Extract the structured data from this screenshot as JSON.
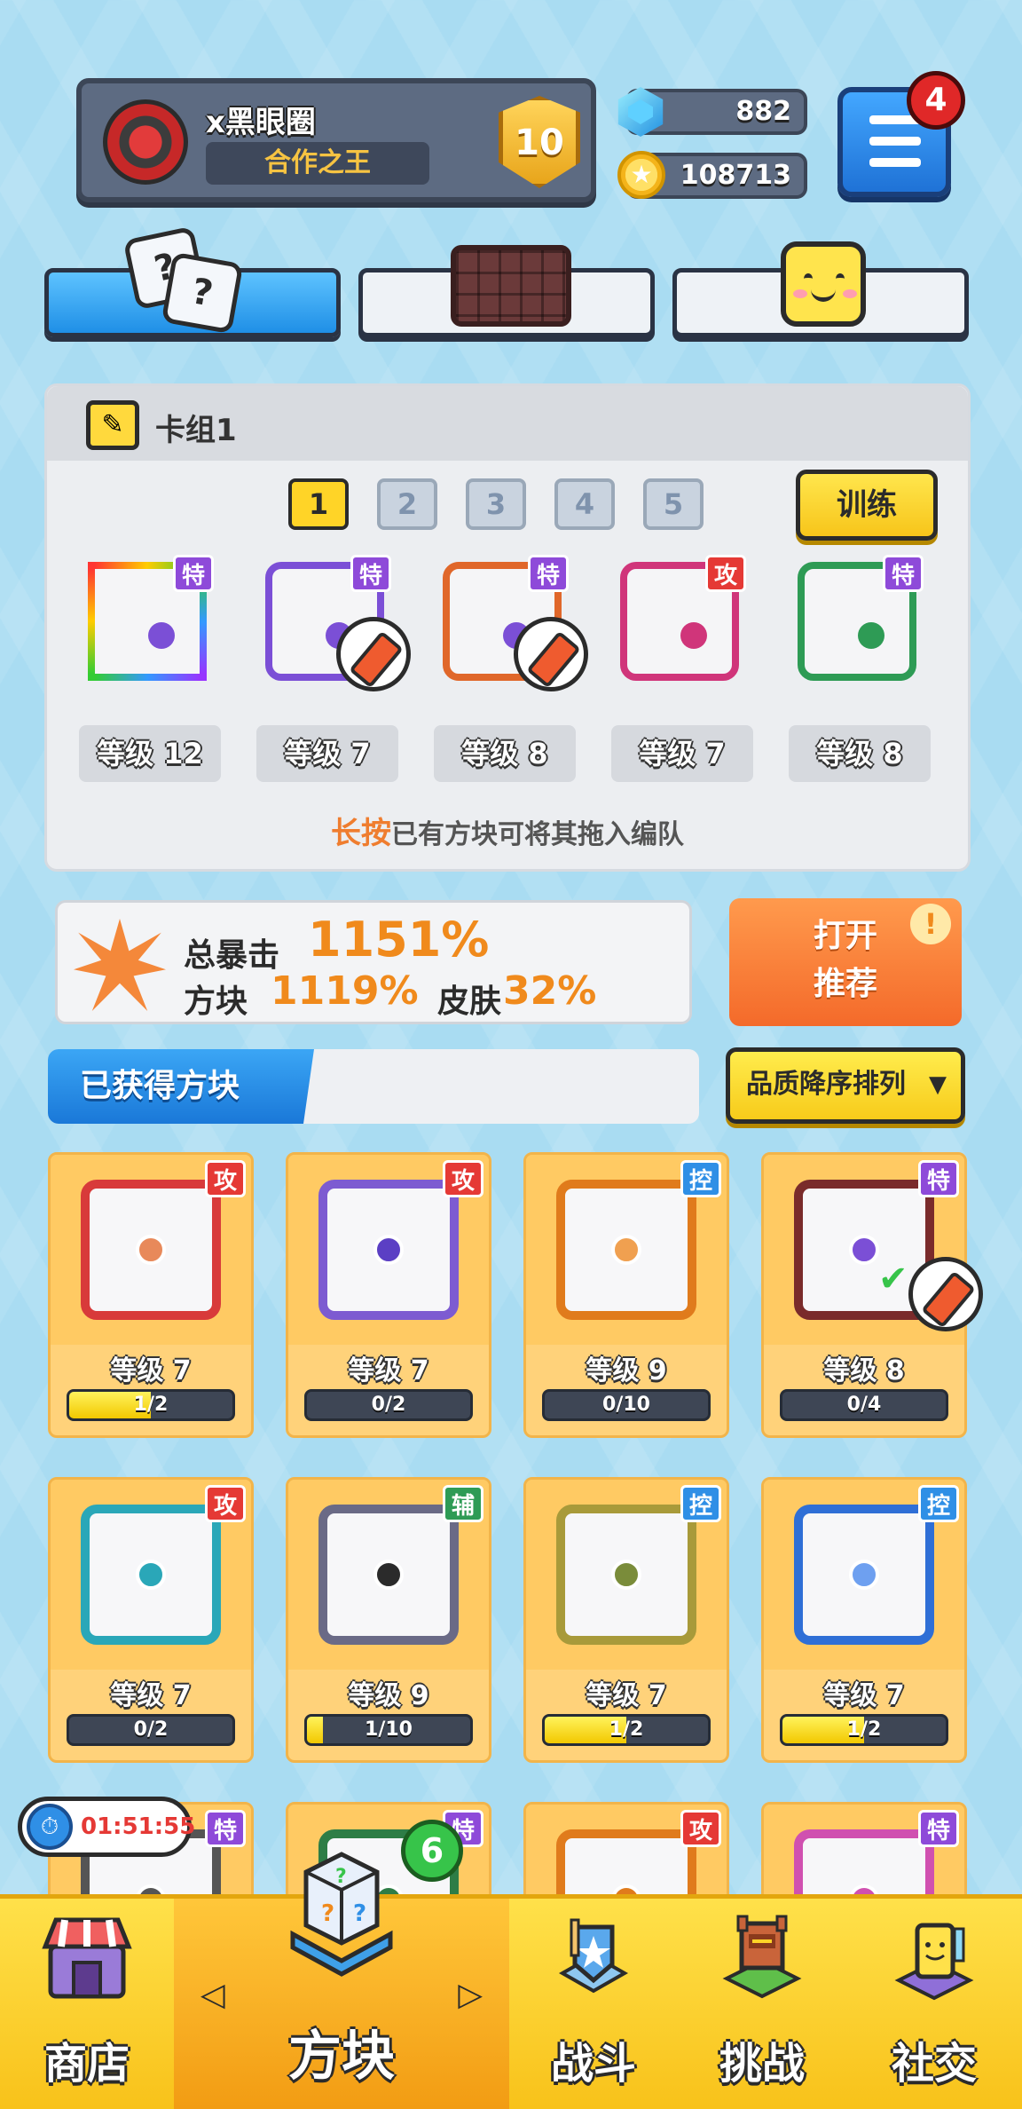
{
  "profile": {
    "name": "x黑眼圈",
    "title": "合作之王",
    "rank": "10"
  },
  "currency": {
    "gems": "882",
    "coins": "108713"
  },
  "menu": {
    "notification_count": "4"
  },
  "mode_tabs": [
    {
      "icon": "dice-icon",
      "active": true
    },
    {
      "icon": "chocolate-board-icon",
      "active": false
    },
    {
      "icon": "smiley-block-icon",
      "active": false
    }
  ],
  "deck": {
    "title": "卡组1",
    "numbers": [
      "1",
      "2",
      "3",
      "4",
      "5"
    ],
    "active_number": "1",
    "train_label": "训练",
    "cards": [
      {
        "tag": "特",
        "level": "等级 12",
        "color": "#7b4fd6"
      },
      {
        "tag": "特",
        "level": "等级 7",
        "color": "#7b4fd6"
      },
      {
        "tag": "特",
        "level": "等级 8",
        "color": "#7b4fd6"
      },
      {
        "tag": "攻",
        "level": "等级 7",
        "color": "#d0357a"
      },
      {
        "tag": "特",
        "level": "等级 8",
        "color": "#2e9b55"
      }
    ],
    "hint_highlight": "长按",
    "hint_rest": "已有方块可将其拖入编队"
  },
  "crit": {
    "total_label": "总暴击",
    "total_value": "1151%",
    "block_label": "方块",
    "block_value": "1119%",
    "skin_label": "皮肤",
    "skin_value": "32%"
  },
  "recommend": {
    "line1": "打开",
    "line2": "推荐",
    "alert": "!"
  },
  "obtained": {
    "tab_label": "已获得方块",
    "sort_label": "品质降序排列",
    "sort_arrow": "▼"
  },
  "blocks": [
    {
      "tag": "攻",
      "tag_type": "gong",
      "level": "等级 7",
      "progress": "1/2",
      "fill": 0.5,
      "frame": "#d83a3a",
      "dot": "#e8895a"
    },
    {
      "tag": "攻",
      "tag_type": "gong",
      "level": "等级 7",
      "progress": "0/2",
      "fill": 0,
      "frame": "#7d5bd1",
      "dot": "#5b3fc4"
    },
    {
      "tag": "控",
      "tag_type": "kong",
      "level": "等级 9",
      "progress": "0/10",
      "fill": 0,
      "frame": "#e07b1c",
      "dot": "#f0a050"
    },
    {
      "tag": "特",
      "tag_type": "te",
      "level": "等级 8",
      "progress": "0/4",
      "fill": 0,
      "frame": "#7a2b2b",
      "dot": "#7b4fd6"
    },
    {
      "tag": "攻",
      "tag_type": "gong",
      "level": "等级 7",
      "progress": "0/2",
      "fill": 0,
      "frame": "#2aa7b8",
      "dot": "#2aa7b8"
    },
    {
      "tag": "辅",
      "tag_type": "fu",
      "level": "等级 9",
      "progress": "1/10",
      "fill": 0.1,
      "frame": "#6a6a86",
      "dot": "#2b2b2b"
    },
    {
      "tag": "控",
      "tag_type": "kong",
      "level": "等级 7",
      "progress": "1/2",
      "fill": 0.5,
      "frame": "#a89a3a",
      "dot": "#7a8c3a"
    },
    {
      "tag": "控",
      "tag_type": "kong",
      "level": "等级 7",
      "progress": "1/2",
      "fill": 0.5,
      "frame": "#2f6fd6",
      "dot": "#6ea0f0"
    },
    {
      "tag": "特",
      "tag_type": "te",
      "level": "",
      "progress": "",
      "fill": 0,
      "frame": "#555",
      "dot": "#555"
    },
    {
      "tag": "特",
      "tag_type": "te",
      "level": "",
      "progress": "",
      "fill": 0,
      "frame": "#2e7d46",
      "dot": "#2e7d46"
    },
    {
      "tag": "攻",
      "tag_type": "gong",
      "level": "",
      "progress": "",
      "fill": 0,
      "frame": "#e07b1c",
      "dot": "#e07b1c"
    },
    {
      "tag": "特",
      "tag_type": "te",
      "level": "",
      "progress": "",
      "fill": 0,
      "frame": "#d050b0",
      "dot": "#d050b0"
    }
  ],
  "timer": {
    "value": "01:51:55"
  },
  "block_chest_count": "6",
  "nav": [
    {
      "label": "商店",
      "icon": "shop-icon",
      "active": false
    },
    {
      "label": "方块",
      "icon": "block-chest-icon",
      "active": true
    },
    {
      "label": "战斗",
      "icon": "battle-icon",
      "active": false
    },
    {
      "label": "挑战",
      "icon": "challenge-icon",
      "active": false
    },
    {
      "label": "社交",
      "icon": "social-icon",
      "active": false
    }
  ],
  "colors": {
    "accent_blue": "#1f8fe6",
    "accent_yellow": "#ffd427",
    "accent_orange": "#f08a1c"
  }
}
